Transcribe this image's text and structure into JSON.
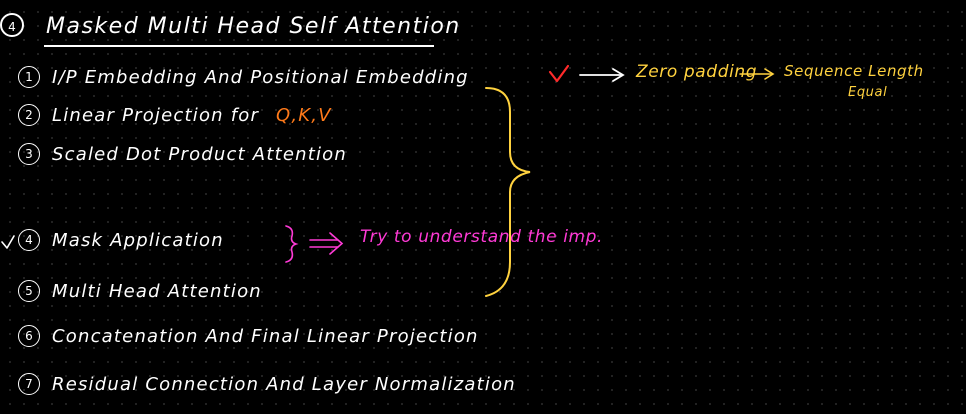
{
  "title": {
    "number": "4",
    "text": "Masked Multi Head Self Attention"
  },
  "steps": [
    {
      "number": "1",
      "text": "I/P Embedding And Positional Embedding"
    },
    {
      "number": "2",
      "text_prefix": "Linear Projection for",
      "text_highlight": "Q,K,V"
    },
    {
      "number": "3",
      "text": "Scaled Dot Product Attention"
    },
    {
      "number": "4",
      "text": "Mask Application"
    },
    {
      "number": "5",
      "text": "Multi Head Attention"
    },
    {
      "number": "6",
      "text": "Concatenation And Final Linear Projection"
    },
    {
      "number": "7",
      "text": "Residual Connection And Layer Normalization"
    }
  ],
  "annotations": {
    "zero_padding": "Zero padding",
    "sequence_length": "Sequence Length",
    "equal": "Equal",
    "try_understand": "Try to understand the imp."
  },
  "colors": {
    "background": "#000000",
    "ink": "#ffffff",
    "highlight": "#ff7a1a",
    "yellow": "#ffd23f",
    "pink": "#ff3ad6",
    "check": "#ff2a2a"
  },
  "icons": [
    "check-icon",
    "arrow-right-icon",
    "curly-brace-icon",
    "implies-arrow-icon"
  ]
}
